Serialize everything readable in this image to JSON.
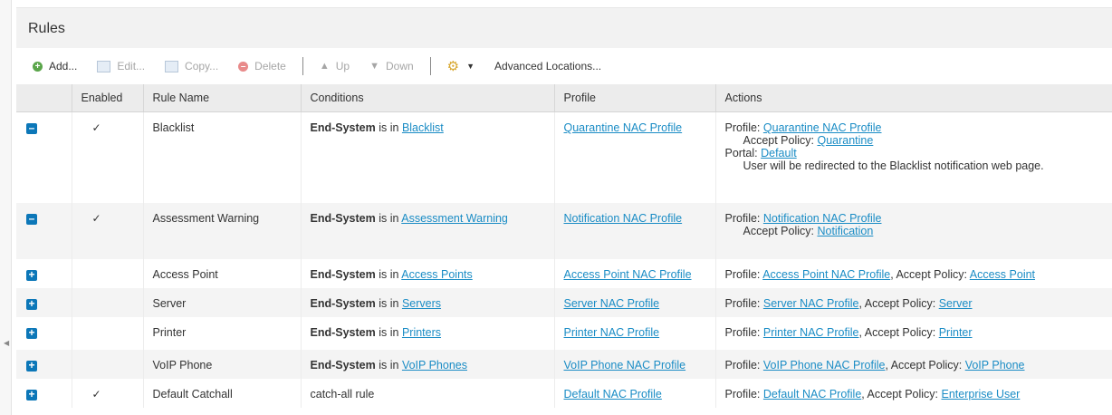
{
  "panel_title": "Rules",
  "toolbar": {
    "add": "Add...",
    "edit": "Edit...",
    "copy": "Copy...",
    "delete": "Delete",
    "up": "Up",
    "down": "Down",
    "advanced": "Advanced Locations..."
  },
  "columns": {
    "enabled": "Enabled",
    "rule_name": "Rule Name",
    "conditions": "Conditions",
    "profile": "Profile",
    "actions": "Actions"
  },
  "labels": {
    "end_system": "End-System",
    "is_in": " is in ",
    "profile_prefix": "Profile: ",
    "accept_policy_prefix": "Accept Policy: ",
    "accept_policy_inline": ", Accept Policy: ",
    "portal_prefix": "Portal: "
  },
  "rows": [
    {
      "expanded": true,
      "enabled": "✓",
      "name": "Blacklist",
      "group": "Blacklist",
      "profile": "Quarantine NAC Profile",
      "action_profile": "Quarantine NAC Profile",
      "accept_policy": "Quarantine",
      "portal": "Default",
      "portal_note": "User will be redirected to the Blacklist notification web page."
    },
    {
      "expanded": true,
      "enabled": "✓",
      "name": "Assessment Warning",
      "group": "Assessment Warning",
      "profile": "Notification NAC Profile",
      "action_profile": "Notification NAC Profile",
      "accept_policy": "Notification"
    },
    {
      "expanded": false,
      "enabled": "",
      "name": "Access Point",
      "group": "Access Points",
      "profile": "Access Point NAC Profile",
      "action_profile": "Access Point NAC Profile",
      "accept_policy": "Access Point"
    },
    {
      "expanded": false,
      "enabled": "",
      "name": "Server",
      "group": "Servers",
      "profile": "Server NAC Profile",
      "action_profile": "Server NAC Profile",
      "accept_policy": "Server"
    },
    {
      "expanded": false,
      "enabled": "",
      "name": "Printer",
      "group": "Printers",
      "profile": "Printer NAC Profile",
      "action_profile": "Printer NAC Profile",
      "accept_policy": "Printer"
    },
    {
      "expanded": false,
      "enabled": "",
      "name": "VoIP Phone",
      "group": "VoIP Phones",
      "profile": "VoIP Phone NAC Profile",
      "action_profile": "VoIP Phone NAC Profile",
      "accept_policy": "VoIP Phone"
    },
    {
      "expanded": false,
      "enabled": "✓",
      "name": "Default Catchall",
      "condition_text": "catch-all rule",
      "profile": "Default NAC Profile",
      "action_profile": "Default NAC Profile",
      "accept_policy": "Enterprise User"
    }
  ]
}
